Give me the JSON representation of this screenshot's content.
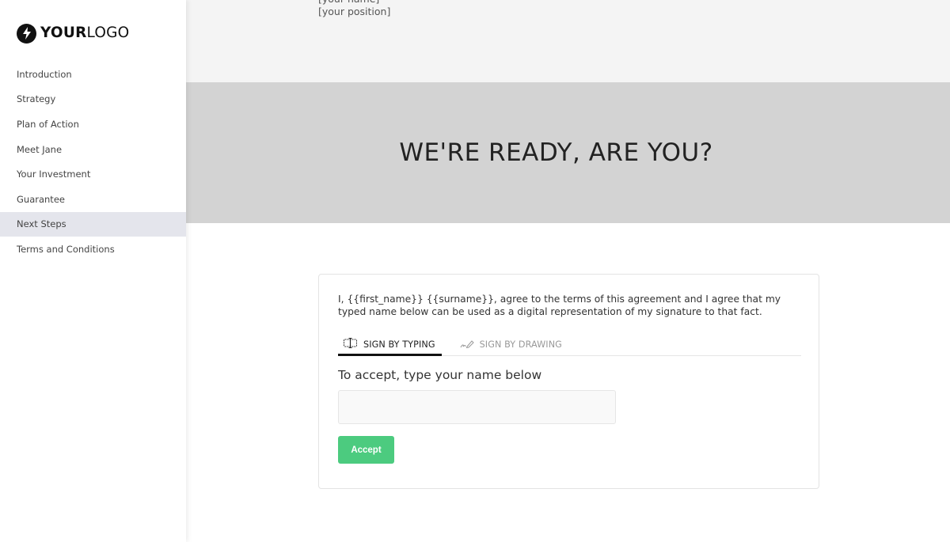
{
  "logo": {
    "icon": "lightning-bolt-icon",
    "text_bold": "YOUR",
    "text_light": "LOGO"
  },
  "sidebar": {
    "items": [
      {
        "label": "Introduction",
        "active": false
      },
      {
        "label": "Strategy",
        "active": false
      },
      {
        "label": "Plan of Action",
        "active": false
      },
      {
        "label": "Meet Jane",
        "active": false
      },
      {
        "label": "Your Investment",
        "active": false
      },
      {
        "label": "Guarantee",
        "active": false
      },
      {
        "label": "Next Steps",
        "active": true
      },
      {
        "label": "Terms and Conditions",
        "active": false
      }
    ]
  },
  "signature_block": {
    "name": "[your name]",
    "position": "[your position]"
  },
  "banner": {
    "heading": "WE'RE READY, ARE YOU?"
  },
  "signing": {
    "agreement_text": "I, {{first_name}} {{surname}}, agree to the terms of this agreement and I agree that my typed name below can be used as a digital representation of my signature to that fact.",
    "tabs": [
      {
        "label": "SIGN BY TYPING",
        "icon": "text-cursor-icon",
        "active": true
      },
      {
        "label": "SIGN BY DRAWING",
        "icon": "pen-signature-icon",
        "active": false
      }
    ],
    "input_label": "To accept, type your name below",
    "input_value": "",
    "input_placeholder": "",
    "accept_button": "Accept"
  },
  "colors": {
    "accent_green": "#4ccb7f",
    "banner_bg": "#d3d3d3",
    "active_nav_bg": "#e4e5ec"
  }
}
